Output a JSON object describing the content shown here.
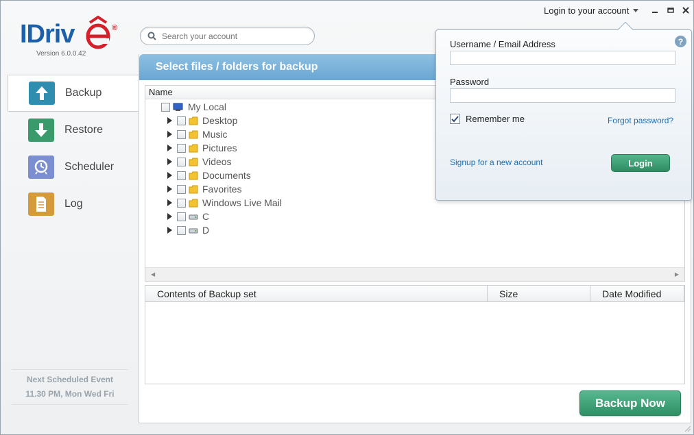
{
  "app": {
    "logo_text": "IDriv",
    "logo_letter_e": "e",
    "version": "Version 6.0.0.42",
    "brand_blue": "#1d5fa8",
    "brand_red": "#d4202a"
  },
  "header": {
    "search_placeholder": "Search your account",
    "login_link": "Login to your account",
    "window_controls": [
      "minimize-icon",
      "maximize-icon",
      "close-icon"
    ]
  },
  "sidebar": {
    "items": [
      {
        "label": "Backup",
        "icon": "backup-up-arrow-icon",
        "active": true,
        "color": "#2f8db0"
      },
      {
        "label": "Restore",
        "icon": "restore-down-arrow-icon",
        "active": false,
        "color": "#3a9a6c"
      },
      {
        "label": "Scheduler",
        "icon": "scheduler-clock-icon",
        "active": false,
        "color": "#7b8fd0"
      },
      {
        "label": "Log",
        "icon": "log-document-icon",
        "active": false,
        "color": "#d49a3c"
      }
    ],
    "next_event_title": "Next Scheduled Event",
    "next_event_time": "11.30 PM, Mon Wed Fri"
  },
  "main": {
    "title": "Select files / folders for backup",
    "tree_header": "Name",
    "tree": [
      {
        "label": "My Local",
        "type": "computer",
        "level": 0
      },
      {
        "label": "Desktop",
        "type": "folder",
        "level": 1
      },
      {
        "label": "Music",
        "type": "folder",
        "level": 1
      },
      {
        "label": "Pictures",
        "type": "folder",
        "level": 1
      },
      {
        "label": "Videos",
        "type": "folder",
        "level": 1
      },
      {
        "label": "Documents",
        "type": "folder",
        "level": 1
      },
      {
        "label": "Favorites",
        "type": "folder",
        "level": 1
      },
      {
        "label": "Windows Live Mail",
        "type": "folder",
        "level": 1
      },
      {
        "label": "C",
        "type": "drive",
        "level": 1
      },
      {
        "label": "D",
        "type": "drive",
        "level": 1
      }
    ],
    "contents_columns": [
      "Contents of Backup set",
      "Size",
      "Date Modified"
    ],
    "backup_now_label": "Backup Now"
  },
  "login_popup": {
    "username_label": "Username / Email Address",
    "username_value": "",
    "password_label": "Password",
    "password_value": "",
    "remember_label": "Remember me",
    "remember_checked": true,
    "forgot_label": "Forgot password?",
    "signup_label": "Signup for a new account",
    "login_label": "Login",
    "help_label": "?"
  }
}
